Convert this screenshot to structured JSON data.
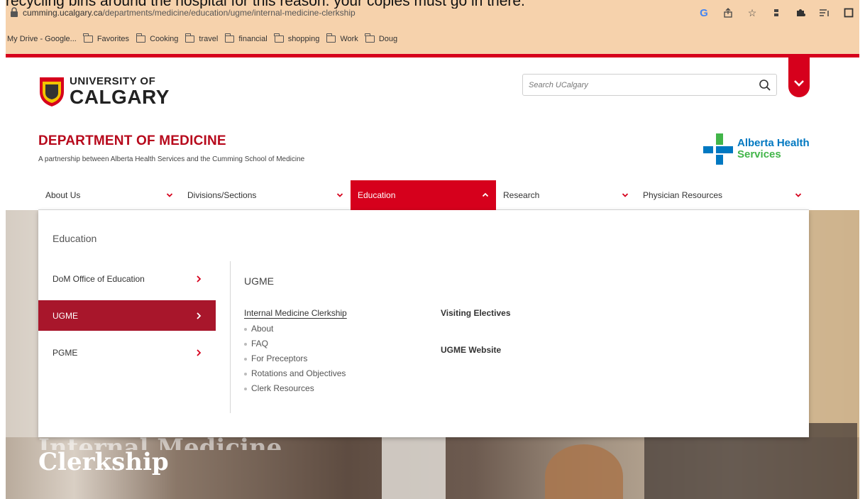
{
  "doc_caption": "recycling bins around the hospital for this reason. your copies must go in there.",
  "browser": {
    "url_host": "cumming.ucalgary.ca",
    "url_path": "/departments/medicine/education/ugme/internal-medicine-clerkship",
    "bookmarks": [
      {
        "label": "My Drive - Google...",
        "icon": "drive-icon"
      },
      {
        "label": "Favorites",
        "icon": "folder-icon"
      },
      {
        "label": "Cooking",
        "icon": "folder-icon"
      },
      {
        "label": "travel",
        "icon": "folder-icon"
      },
      {
        "label": "financial",
        "icon": "folder-icon"
      },
      {
        "label": "shopping",
        "icon": "folder-icon"
      },
      {
        "label": "Work",
        "icon": "folder-icon"
      },
      {
        "label": "Doug",
        "icon": "folder-icon"
      }
    ],
    "toolbar_icons": [
      "google-icon",
      "share-icon",
      "star-icon",
      "extension-icon",
      "puzzle-icon",
      "reading-list-icon",
      "side-panel-icon"
    ]
  },
  "site": {
    "logo_line1": "UNIVERSITY OF",
    "logo_line2": "CALGARY",
    "search_placeholder": "Search UCalgary",
    "dept_title": "DEPARTMENT OF MEDICINE",
    "dept_subtitle": "A partnership between Alberta Health Services and the Cumming School of Medicine",
    "partner_line1": "Alberta Health",
    "partner_line2": "Services",
    "accent": "#d6001c",
    "accent_dark": "#a8162b"
  },
  "nav": [
    {
      "label": "About Us",
      "active": false
    },
    {
      "label": "Divisions/Sections",
      "active": false
    },
    {
      "label": "Education",
      "active": true
    },
    {
      "label": "Research",
      "active": false
    },
    {
      "label": "Physician Resources",
      "active": false
    }
  ],
  "dropdown": {
    "heading": "Education",
    "side_items": [
      {
        "label": "DoM Office of Education",
        "active": false
      },
      {
        "label": "UGME",
        "active": true
      },
      {
        "label": "PGME",
        "active": false
      }
    ],
    "sub_heading": "UGME",
    "column1": {
      "title": "Internal Medicine Clerkship",
      "items": [
        "About",
        "FAQ",
        "For Preceptors",
        "Rotations and Objectives",
        "Clerk Resources"
      ]
    },
    "column2": [
      "Visiting Electives",
      "UGME Website"
    ]
  },
  "hero": {
    "title_line1": "Internal Medicine",
    "title_line2": "Clerkship"
  }
}
